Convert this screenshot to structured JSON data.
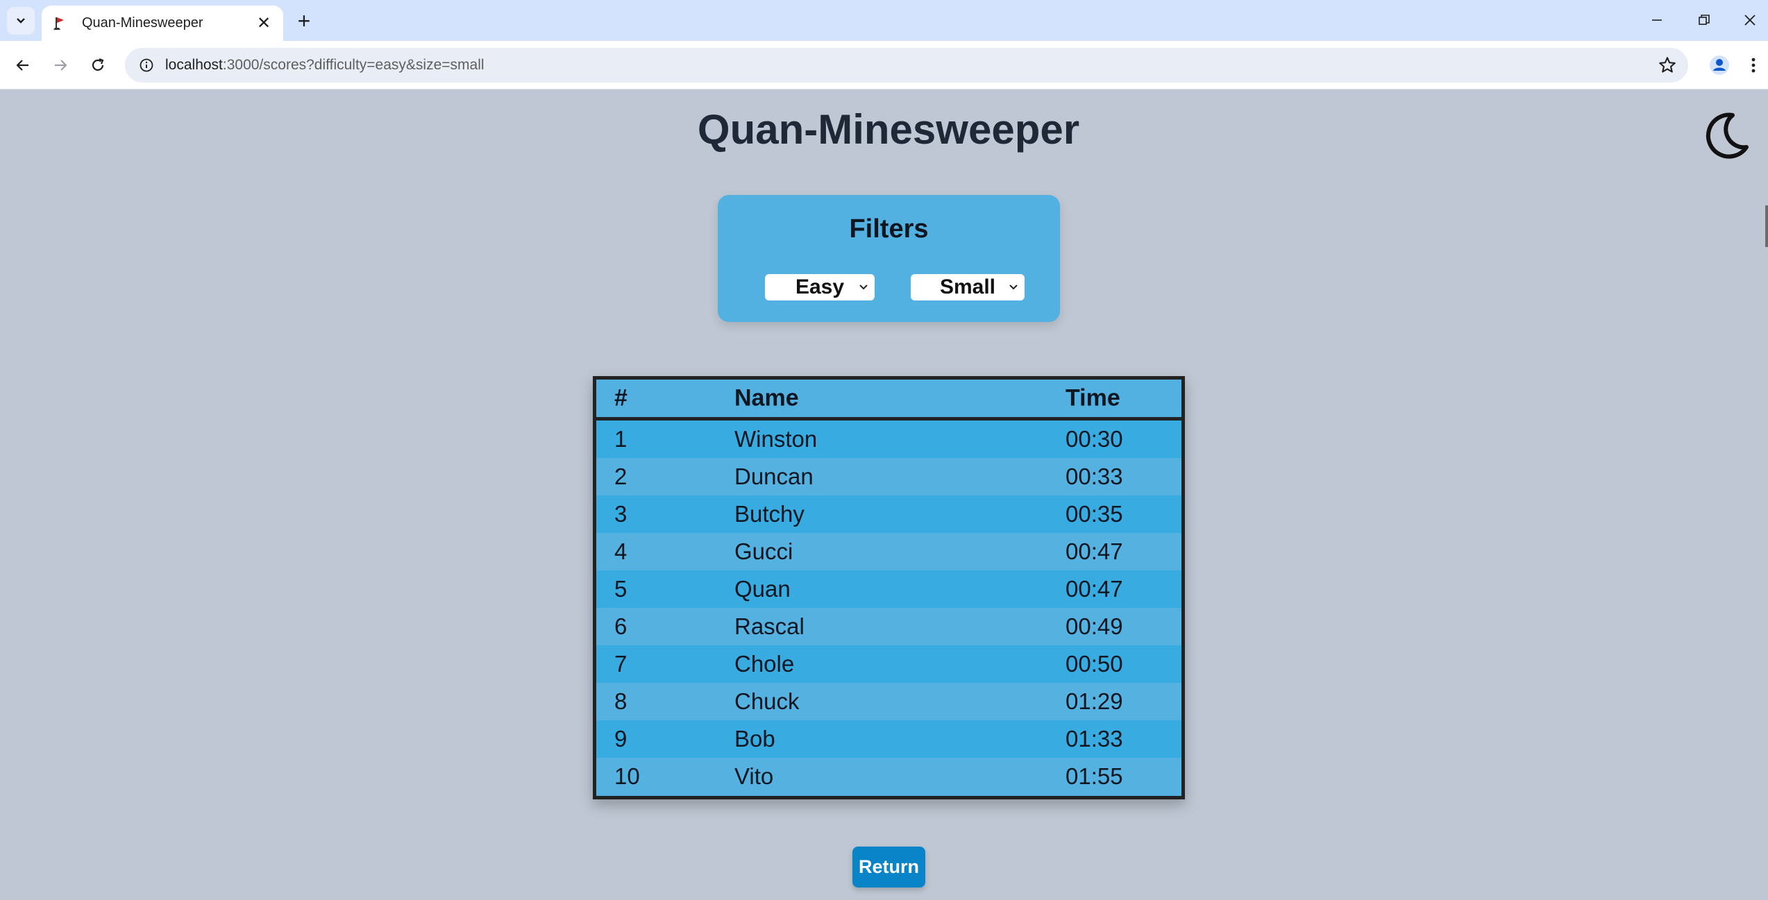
{
  "browser": {
    "tab_title": "Quan-Minesweeper",
    "url_host": "localhost",
    "url_rest": ":3000/scores?difficulty=easy&size=small"
  },
  "page": {
    "title": "Quan-Minesweeper",
    "theme_icon": "moon-icon"
  },
  "filters": {
    "title": "Filters",
    "difficulty": "Easy",
    "size": "Small"
  },
  "scores": {
    "headers": {
      "rank": "#",
      "name": "Name",
      "time": "Time"
    },
    "rows": [
      {
        "rank": "1",
        "name": "Winston",
        "time": "00:30"
      },
      {
        "rank": "2",
        "name": "Duncan",
        "time": "00:33"
      },
      {
        "rank": "3",
        "name": "Butchy",
        "time": "00:35"
      },
      {
        "rank": "4",
        "name": "Gucci",
        "time": "00:47"
      },
      {
        "rank": "5",
        "name": "Quan",
        "time": "00:47"
      },
      {
        "rank": "6",
        "name": "Rascal",
        "time": "00:49"
      },
      {
        "rank": "7",
        "name": "Chole",
        "time": "00:50"
      },
      {
        "rank": "8",
        "name": "Chuck",
        "time": "01:29"
      },
      {
        "rank": "9",
        "name": "Bob",
        "time": "01:33"
      },
      {
        "rank": "10",
        "name": "Vito",
        "time": "01:55"
      }
    ]
  },
  "return_label": "Return",
  "colors": {
    "background": "#bec7d3",
    "panel": "#52b1e1",
    "row_odd": "#38abe1",
    "row_even": "#55b2e0",
    "button": "#0a84c9"
  }
}
